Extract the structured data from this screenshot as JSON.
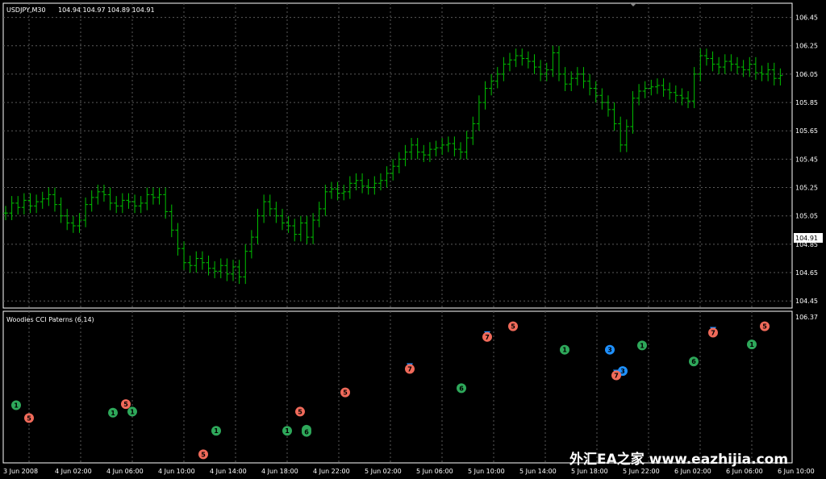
{
  "window": {
    "symbol_info": "USDJPY,M30",
    "ohlc_readout": "104.94 104.97 104.89 104.91",
    "current_price": "104.91"
  },
  "indicator": {
    "title": "Woodies CCI Paterns (6,14)",
    "scale_top": "106.37"
  },
  "watermark": "外汇EA之家 www.eazhijia.com",
  "colors": {
    "background": "#000000",
    "bar": "#00c000",
    "grid": "#5a5a5a",
    "signal_green": "#2ea85a",
    "signal_salmon": "#f06a5a",
    "signal_blue": "#1e90ff",
    "signal_pattern_a": "#1e90ff"
  },
  "chart_data": {
    "type": "bar",
    "price_axis_ticks": [
      "106.45",
      "106.25",
      "106.05",
      "105.85",
      "105.65",
      "105.45",
      "105.25",
      "105.05",
      "104.85",
      "104.65",
      "104.45"
    ],
    "time_axis_labels": [
      "3 Jun 2008",
      "4 Jun 02:00",
      "4 Jun 06:00",
      "4 Jun 10:00",
      "4 Jun 14:00",
      "4 Jun 18:00",
      "4 Jun 22:00",
      "5 Jun 02:00",
      "5 Jun 06:00",
      "5 Jun 10:00",
      "5 Jun 14:00",
      "5 Jun 18:00",
      "5 Jun 22:00",
      "6 Jun 02:00",
      "6 Jun 06:00",
      "6 Jun 10:00"
    ],
    "ylim": [
      104.4,
      106.55
    ],
    "grid": true,
    "price_closes": [
      105.07,
      105.14,
      105.11,
      105.16,
      105.12,
      105.15,
      105.17,
      105.2,
      105.13,
      105.05,
      105.0,
      104.98,
      105.02,
      105.13,
      105.18,
      105.22,
      105.2,
      105.14,
      105.12,
      105.16,
      105.15,
      105.12,
      105.14,
      105.2,
      105.18,
      105.2,
      105.08,
      104.95,
      104.82,
      104.72,
      104.7,
      104.75,
      104.72,
      104.68,
      104.66,
      104.7,
      104.64,
      104.69,
      104.62,
      104.8,
      104.9,
      105.05,
      105.15,
      105.1,
      105.05,
      105.0,
      104.98,
      104.92,
      105.0,
      104.9,
      105.02,
      105.1,
      105.22,
      105.24,
      105.21,
      105.22,
      105.28,
      105.3,
      105.26,
      105.25,
      105.28,
      105.3,
      105.35,
      105.4,
      105.45,
      105.5,
      105.55,
      105.5,
      105.48,
      105.52,
      105.53,
      105.55,
      105.56,
      105.52,
      105.5,
      105.6,
      105.7,
      105.85,
      105.95,
      106.0,
      106.05,
      106.12,
      106.15,
      106.18,
      106.16,
      106.14,
      106.1,
      106.05,
      106.08,
      106.2,
      106.05,
      105.98,
      106.02,
      106.05,
      106.0,
      105.95,
      105.9,
      105.85,
      105.8,
      105.7,
      105.55,
      105.68,
      105.88,
      105.93,
      105.95,
      105.96,
      105.97,
      105.94,
      105.92,
      105.9,
      105.88,
      105.86,
      106.05,
      106.18,
      106.16,
      106.12,
      106.1,
      106.14,
      106.12,
      106.1,
      106.08,
      106.12,
      106.06,
      106.05,
      106.08,
      106.02,
      106.04
    ],
    "signals": [
      {
        "label": "1",
        "type": "green",
        "value": 40
      },
      {
        "label": "5",
        "type": "salmon",
        "value": -20
      },
      {
        "label": "1",
        "type": "green",
        "value": 5
      },
      {
        "label": "5",
        "type": "salmon",
        "value": 45
      },
      {
        "label": "1",
        "type": "green",
        "value": 10
      },
      {
        "label": "1",
        "type": "green",
        "value": -80
      },
      {
        "label": "5",
        "type": "salmon",
        "value": -190
      },
      {
        "label": "1",
        "type": "green",
        "value": -80
      },
      {
        "label": "5",
        "type": "salmon",
        "value": 10
      },
      {
        "label": "6",
        "type": "green",
        "value": -75
      },
      {
        "label": "6",
        "type": "green",
        "value": -85
      },
      {
        "label": "5",
        "type": "salmon",
        "value": 100
      },
      {
        "label": "7",
        "type": "salmon_blue",
        "value": 210
      },
      {
        "label": "6",
        "type": "green",
        "value": 120
      },
      {
        "label": "7",
        "type": "salmon_blue",
        "value": 360
      },
      {
        "label": "5",
        "type": "salmon",
        "value": 410
      },
      {
        "label": "1",
        "type": "green",
        "value": 300
      },
      {
        "label": "3",
        "type": "blue",
        "value": 300
      },
      {
        "label": "3",
        "type": "blue",
        "value": 200
      },
      {
        "label": "7",
        "type": "salmon_blue",
        "value": 180
      },
      {
        "label": "1",
        "type": "green",
        "value": 320
      },
      {
        "label": "6",
        "type": "green",
        "value": 245
      },
      {
        "label": "7",
        "type": "salmon_blue",
        "value": 380
      },
      {
        "label": "1",
        "type": "green",
        "value": 325
      },
      {
        "label": "5",
        "type": "salmon",
        "value": 410
      }
    ],
    "indicator_ylim": [
      -200,
      450
    ]
  }
}
